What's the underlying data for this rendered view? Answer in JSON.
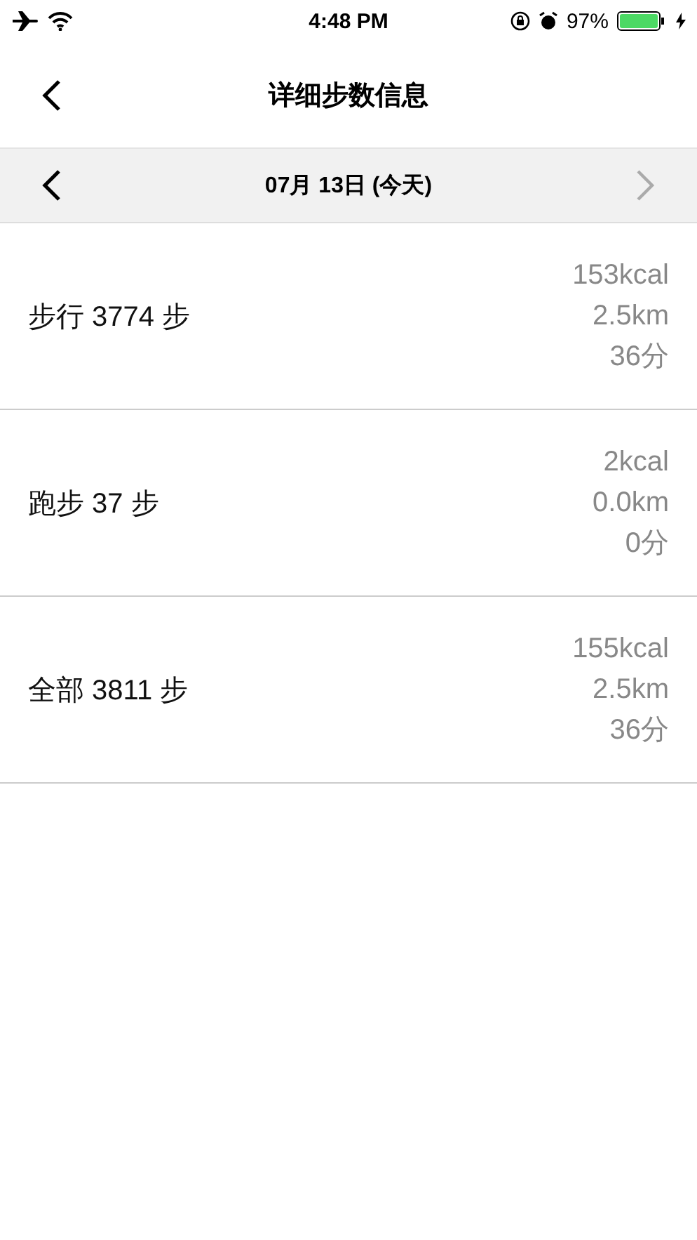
{
  "status_bar": {
    "time": "4:48 PM",
    "battery": "97%"
  },
  "nav": {
    "title": "详细步数信息"
  },
  "date_bar": {
    "date": "07月 13日 (今天)",
    "next_disabled": true
  },
  "rows": [
    {
      "label": "步行 3774 步",
      "calories": "153kcal",
      "distance": "2.5km",
      "duration": "36分"
    },
    {
      "label": "跑步 37 步",
      "calories": "2kcal",
      "distance": "0.0km",
      "duration": "0分"
    },
    {
      "label": "全部 3811 步",
      "calories": "155kcal",
      "distance": "2.5km",
      "duration": "36分"
    }
  ]
}
